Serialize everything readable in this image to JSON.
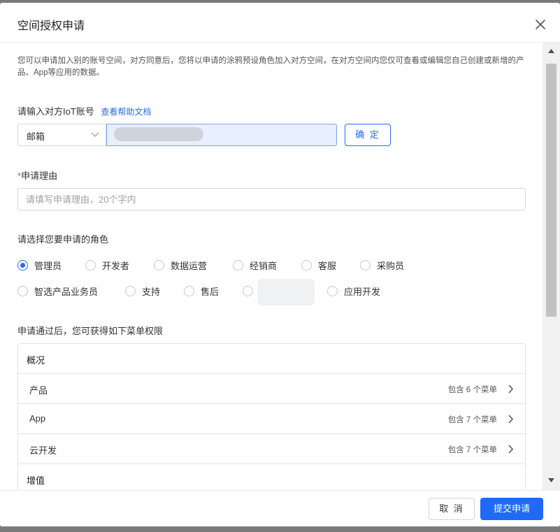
{
  "dialog": {
    "title": "空间授权申请",
    "intro": "您可以申请加入别的账号空间，对方同意后，您将以申请的涂鸦预设角色加入对方空间，在对方空间内您仅可查看或编辑您自己创建或新增的产品、App等应用的数据。"
  },
  "account": {
    "label": "请输入对方IoT账号",
    "help_link": "查看帮助文档",
    "type_value": "邮箱",
    "confirm_label": "确 定"
  },
  "reason": {
    "required_mark": "*",
    "label": "申请理由",
    "placeholder": "请填写申请理由，20个字内"
  },
  "roles": {
    "label": "请选择您要申请的角色",
    "options": [
      "管理员",
      "开发者",
      "数据运营",
      "经销商",
      "客服",
      "采购员",
      "智选产品业务员",
      "支持",
      "售后",
      "",
      "应用开发"
    ],
    "selected": "管理员"
  },
  "permissions": {
    "label": "申请通过后，您可获得如下菜单权限",
    "groups": [
      {
        "name": "概况"
      },
      {
        "name": "产品",
        "count": "包含 6 个菜单"
      },
      {
        "name": "App",
        "count": "包含 7 个菜单"
      },
      {
        "name": "云开发",
        "count": "包含 7 个菜单"
      },
      {
        "name": "增值"
      }
    ]
  },
  "footer": {
    "cancel_label": "取 消",
    "submit_label": "提交申请"
  },
  "colors": {
    "primary": "#1f6af5",
    "required": "#e5484d"
  }
}
